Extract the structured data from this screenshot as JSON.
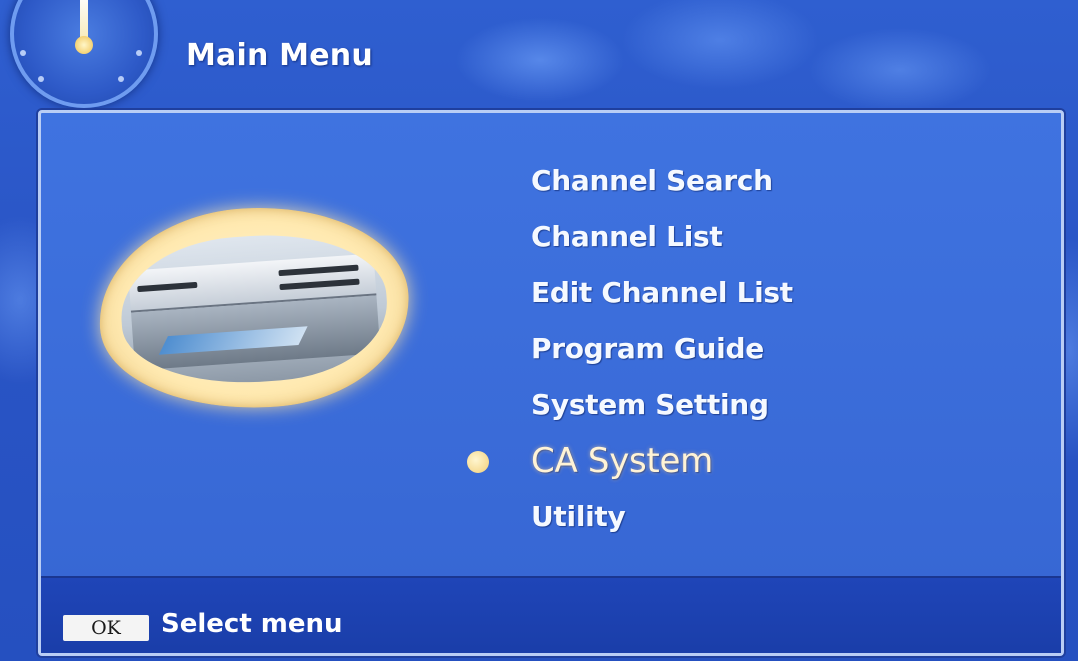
{
  "header": {
    "title": "Main Menu",
    "icon": "clock-dial-icon"
  },
  "main": {
    "picture": "set-top-box-icon",
    "menu_items": [
      {
        "label": "Channel Search",
        "selected": false
      },
      {
        "label": "Channel List",
        "selected": false
      },
      {
        "label": "Edit Channel List",
        "selected": false
      },
      {
        "label": "Program Guide",
        "selected": false
      },
      {
        "label": "System Setting",
        "selected": false
      },
      {
        "label": "CA System",
        "selected": true
      },
      {
        "label": "Utility",
        "selected": false
      }
    ],
    "selection_marker": "bullet-icon"
  },
  "footer": {
    "key_label": "OK",
    "hint": "Select menu"
  },
  "colors": {
    "background": "#2a55c6",
    "panel": "#3a6bd8",
    "footer": "#1f45b8",
    "selected_text": "#fff3d6",
    "bullet": "#f2cf78"
  }
}
